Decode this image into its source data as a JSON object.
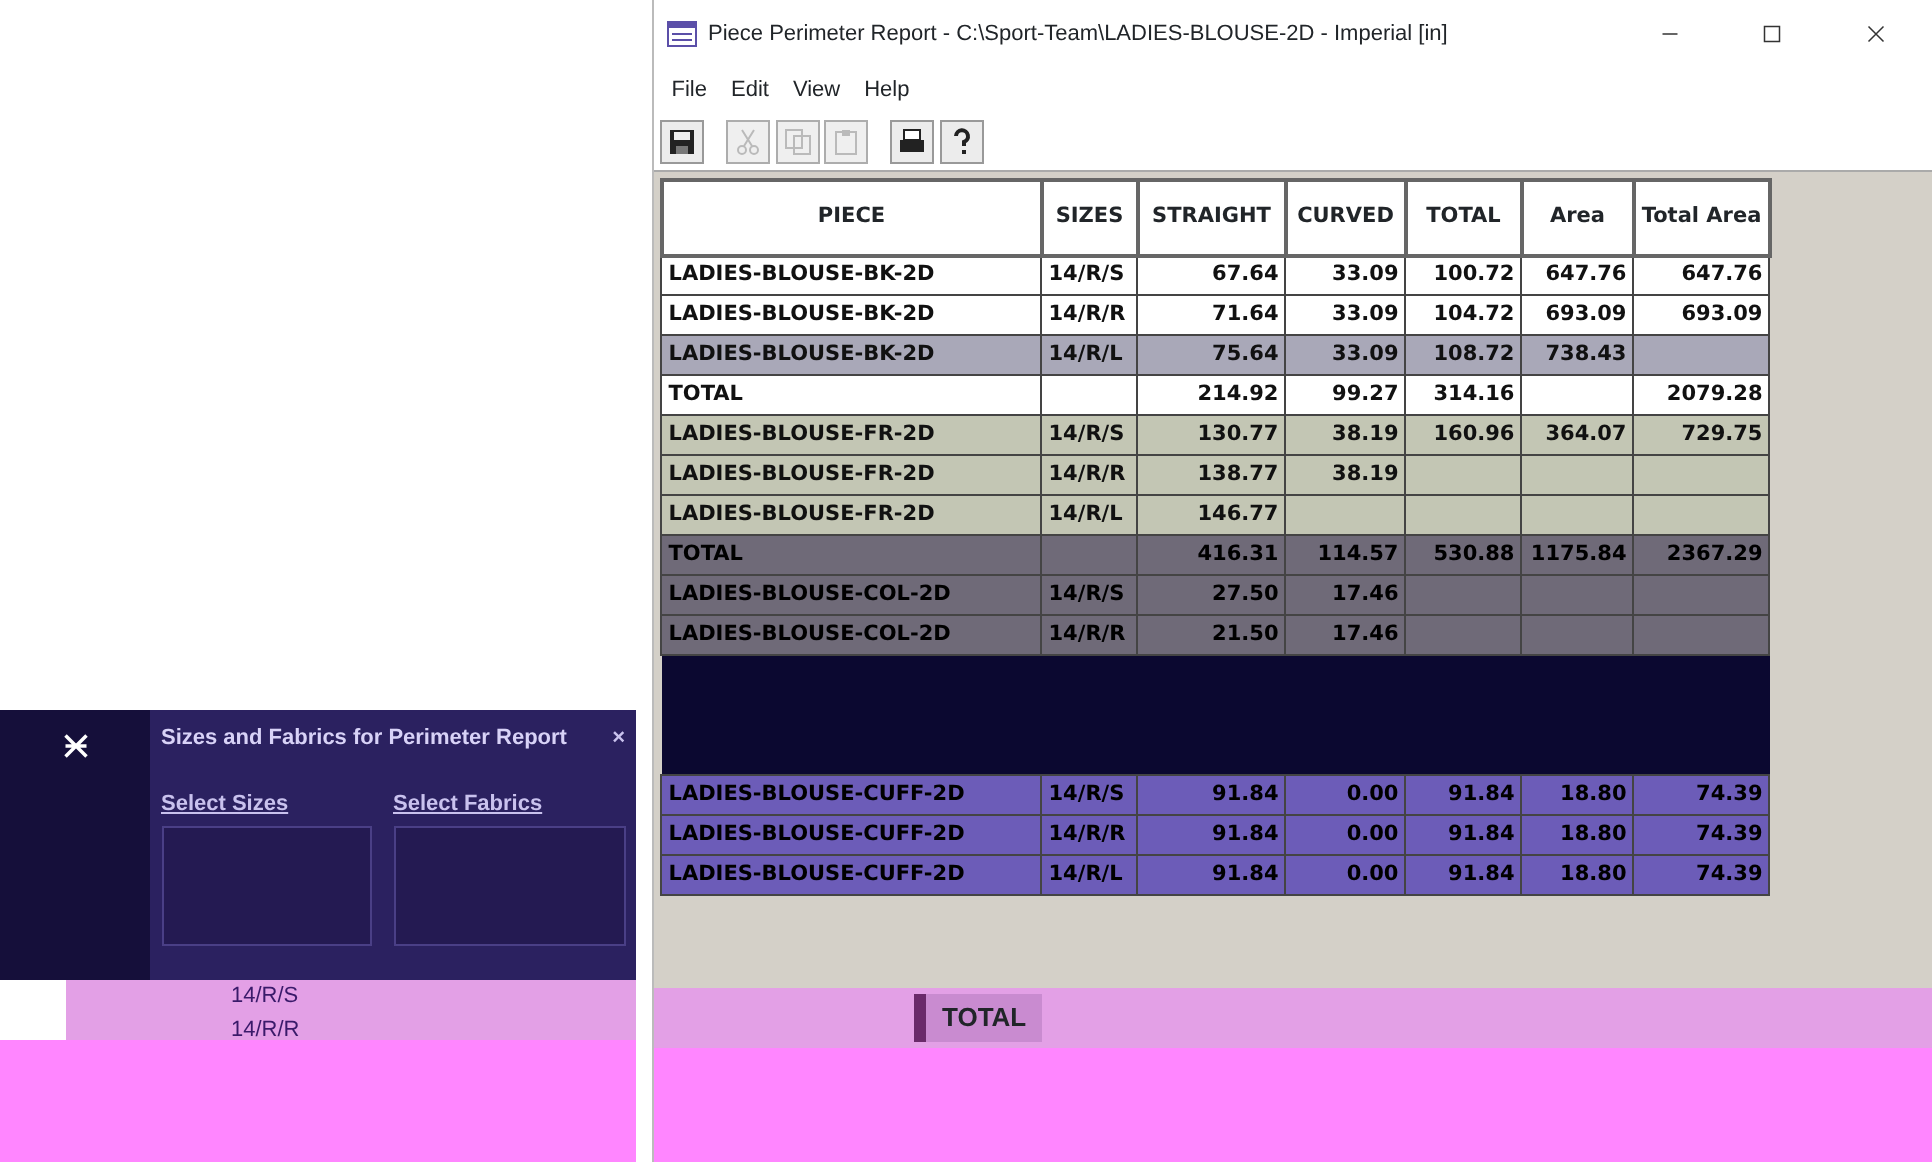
{
  "window": {
    "title": "Piece Perimeter Report - C:\\Sport-Team\\LADIES-BLOUSE-2D - Imperial [in]"
  },
  "menu": [
    "File",
    "Edit",
    "View",
    "Help"
  ],
  "toolbar": [
    {
      "kind": "save",
      "disabled": false
    },
    {
      "kind": "cut",
      "disabled": true
    },
    {
      "kind": "copy",
      "disabled": true
    },
    {
      "kind": "paste",
      "disabled": true
    },
    {
      "kind": "print",
      "disabled": false
    },
    {
      "kind": "help",
      "disabled": false
    }
  ],
  "table": {
    "columns": [
      "PIECE",
      "SIZES",
      "STRAIGHT",
      "CURVED",
      "TOTAL",
      "Area",
      "Total Area"
    ],
    "groups": [
      {
        "rows": [
          {
            "selected": false,
            "cells": [
              "LADIES-BLOUSE-BK-2D",
              "14/R/S",
              "67.64",
              "33.09",
              "100.72",
              "647.76",
              "647.76"
            ]
          },
          {
            "selected": false,
            "cells": [
              "LADIES-BLOUSE-BK-2D",
              "14/R/R",
              "71.64",
              "33.09",
              "104.72",
              "693.09",
              "693.09"
            ]
          },
          {
            "selected": true,
            "cells": [
              "LADIES-BLOUSE-BK-2D",
              "14/R/L",
              "75.64",
              "33.09",
              "108.72",
              "738.43",
              null
            ]
          },
          {
            "selected": false,
            "cells": [
              "TOTAL",
              null,
              "214.92",
              "99.27",
              "314.16",
              null,
              "2079.28"
            ]
          }
        ]
      },
      {
        "rows": [
          {
            "selected": false,
            "cells": [
              "LADIES-BLOUSE-FR-2D",
              "14/R/S",
              "130.77",
              "38.19",
              "160.96",
              "364.07",
              "729.75"
            ]
          },
          {
            "selected": false,
            "cells": [
              "LADIES-BLOUSE-FR-2D",
              "14/R/R",
              "138.77",
              "38.19",
              null,
              null,
              null
            ]
          },
          {
            "selected": false,
            "cells": [
              "LADIES-BLOUSE-FR-2D",
              "14/R/L",
              "146.77",
              null,
              null,
              null,
              null
            ]
          }
        ]
      },
      {
        "rows": [
          {
            "selected": false,
            "cells": [
              "TOTAL",
              null,
              "416.31",
              "114.57",
              "530.88",
              "1175.84",
              "2367.29"
            ]
          },
          {
            "selected": false,
            "cells": [
              "LADIES-BLOUSE-COL-2D",
              "14/R/S",
              "27.50",
              "17.46",
              null,
              null,
              null
            ]
          },
          {
            "selected": false,
            "cells": [
              "LADIES-BLOUSE-COL-2D",
              "14/R/R",
              "21.50",
              "17.46",
              null,
              null,
              null
            ]
          }
        ]
      },
      {
        "rows": [
          {
            "selected": false,
            "cells": [
              "LADIES-BLOUSE-CUFF-2D",
              "14/R/S",
              "91.84",
              "0.00",
              "91.84",
              "18.80",
              "74.39"
            ]
          },
          {
            "selected": false,
            "cells": [
              "LADIES-BLOUSE-CUFF-2D",
              "14/R/R",
              "91.84",
              "0.00",
              "91.84",
              "18.80",
              "74.39"
            ]
          },
          {
            "selected": false,
            "cells": [
              "LADIES-BLOUSE-CUFF-2D",
              "14/R/L",
              "91.84",
              "0.00",
              "91.84",
              "18.80",
              "74.39"
            ]
          }
        ]
      }
    ]
  },
  "bottom_label": "TOTAL",
  "dialog": {
    "title": "Sizes and Fabrics for Perimeter Report",
    "close": "×",
    "sizes_label": "Select Sizes",
    "fabrics_label": "Select Fabrics",
    "sizes": [
      "14/R/S",
      "14/R/R"
    ]
  }
}
